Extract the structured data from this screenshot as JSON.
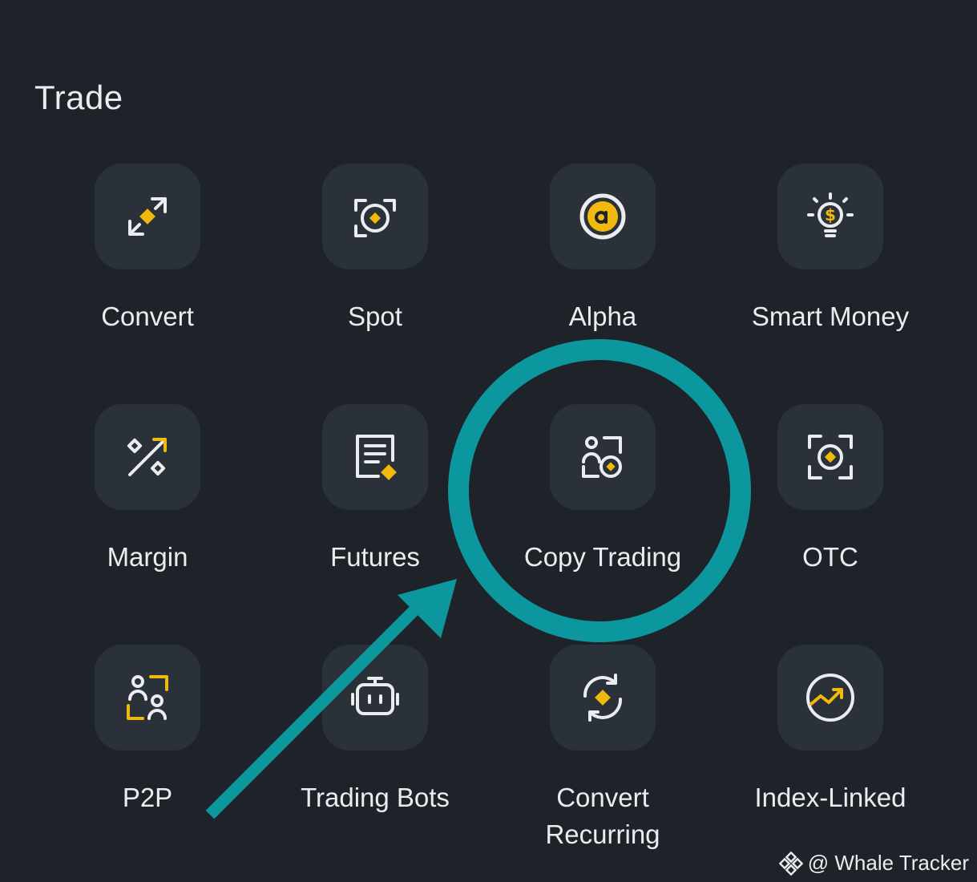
{
  "section": {
    "title": "Trade"
  },
  "tiles": [
    {
      "label": "Convert",
      "icon": "convert-icon"
    },
    {
      "label": "Spot",
      "icon": "spot-icon"
    },
    {
      "label": "Alpha",
      "icon": "alpha-icon"
    },
    {
      "label": "Smart Money",
      "icon": "smart-money-icon"
    },
    {
      "label": "Margin",
      "icon": "margin-icon"
    },
    {
      "label": "Futures",
      "icon": "futures-icon"
    },
    {
      "label": "Copy Trading",
      "icon": "copy-trading-icon"
    },
    {
      "label": "OTC",
      "icon": "otc-icon"
    },
    {
      "label": "P2P",
      "icon": "p2p-icon"
    },
    {
      "label": "Trading Bots",
      "icon": "trading-bots-icon"
    },
    {
      "label": "Convert\nRecurring",
      "icon": "convert-recurring-icon"
    },
    {
      "label": "Index-Linked",
      "icon": "index-linked-icon"
    }
  ],
  "annotation": {
    "highlighted_item": "Copy Trading",
    "color": "#0b979d"
  },
  "watermark": {
    "text": "@ Whale Tracker"
  },
  "colors": {
    "background": "#1e2329",
    "tile": "#2b3139",
    "accent": "#f0b90b",
    "icon_line": "#eaecef"
  }
}
